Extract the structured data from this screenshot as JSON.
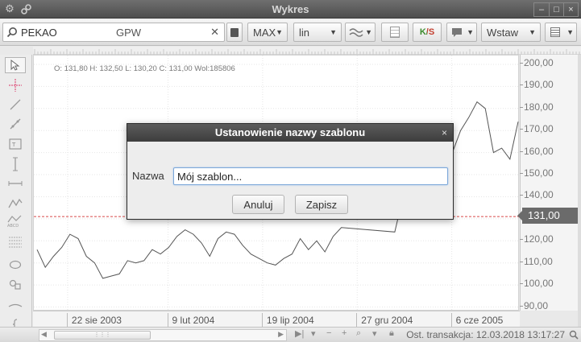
{
  "window": {
    "title": "Wykres"
  },
  "toolbar": {
    "search_value": "PEKAO",
    "ticker": "GPW",
    "range": "MAX",
    "scale": "lin",
    "indicator_label": "K/S",
    "save_label": "Wstaw",
    "colors": {
      "ks_green": "#3a8a2a",
      "ks_red": "#c23b2b"
    }
  },
  "chart": {
    "ohlc": "O: 131,80 H: 132,50 L: 130,20 C: 131,00 Wol:185806",
    "y_ticks": [
      "200,00",
      "190,00",
      "180,00",
      "170,00",
      "160,00",
      "150,00",
      "140,00",
      "130,00",
      "120,00",
      "110,00",
      "100,00",
      "90,00"
    ],
    "last_price": "131,00",
    "x_ticks": [
      "22 sie 2003",
      "9 lut 2004",
      "19 lip 2004",
      "27 gru 2004",
      "6 cze 2005"
    ],
    "colors": {
      "line": "#555555",
      "price_line": "#d64848"
    }
  },
  "chart_data": {
    "type": "line",
    "title": "",
    "xlabel": "",
    "ylabel": "",
    "ylim": [
      88,
      204
    ],
    "x": [
      "2003-07-01",
      "2003-07-15",
      "2003-07-29",
      "2003-08-12",
      "2003-08-26",
      "2003-09-09",
      "2003-09-23",
      "2003-10-07",
      "2003-10-21",
      "2003-11-04",
      "2003-11-18",
      "2003-12-02",
      "2003-12-16",
      "2003-12-30",
      "2004-01-13",
      "2004-01-27",
      "2004-02-10",
      "2004-02-24",
      "2004-03-09",
      "2004-03-23",
      "2004-04-06",
      "2004-04-20",
      "2004-05-04",
      "2004-05-18",
      "2004-06-01",
      "2004-06-15",
      "2004-06-29",
      "2004-07-13",
      "2004-07-27",
      "2004-08-10",
      "2004-08-24",
      "2004-09-07",
      "2004-09-21",
      "2004-10-05",
      "2004-10-19",
      "2004-11-02",
      "2004-11-16",
      "2004-11-30",
      "2005-03-01",
      "2005-03-15",
      "2005-03-29",
      "2005-04-12",
      "2005-04-26",
      "2005-05-10",
      "2005-05-24",
      "2005-06-07",
      "2005-06-21",
      "2005-07-05",
      "2005-07-19",
      "2005-08-02",
      "2005-08-16",
      "2005-08-30",
      "2005-09-13",
      "2005-09-27"
    ],
    "series": [
      {
        "values": [
          116,
          108,
          113,
          117,
          123,
          121,
          113,
          110,
          103,
          104,
          105,
          111,
          110,
          111,
          116,
          114,
          117,
          122,
          125,
          123,
          119,
          113,
          121,
          124,
          123,
          118,
          114,
          112,
          110,
          109,
          112,
          114,
          121,
          116,
          120,
          115,
          122,
          126,
          124,
          140,
          146,
          150,
          153,
          160,
          165,
          160,
          170,
          176,
          183,
          180,
          160,
          162,
          157,
          174
        ]
      }
    ],
    "reference_line": {
      "value": 131.0
    }
  },
  "statusbar": {
    "last_transaction": "Ost. transakcja: 12.03.2018 13:17:27",
    "thumb_grip": "⋮⋮⋮"
  },
  "dialog": {
    "title": "Ustanowienie nazwy szablonu",
    "close": "×",
    "name_label": "Nazwa",
    "name_value": "Mój szablon...",
    "cancel_label": "Anuluj",
    "save_label": "Zapisz"
  }
}
